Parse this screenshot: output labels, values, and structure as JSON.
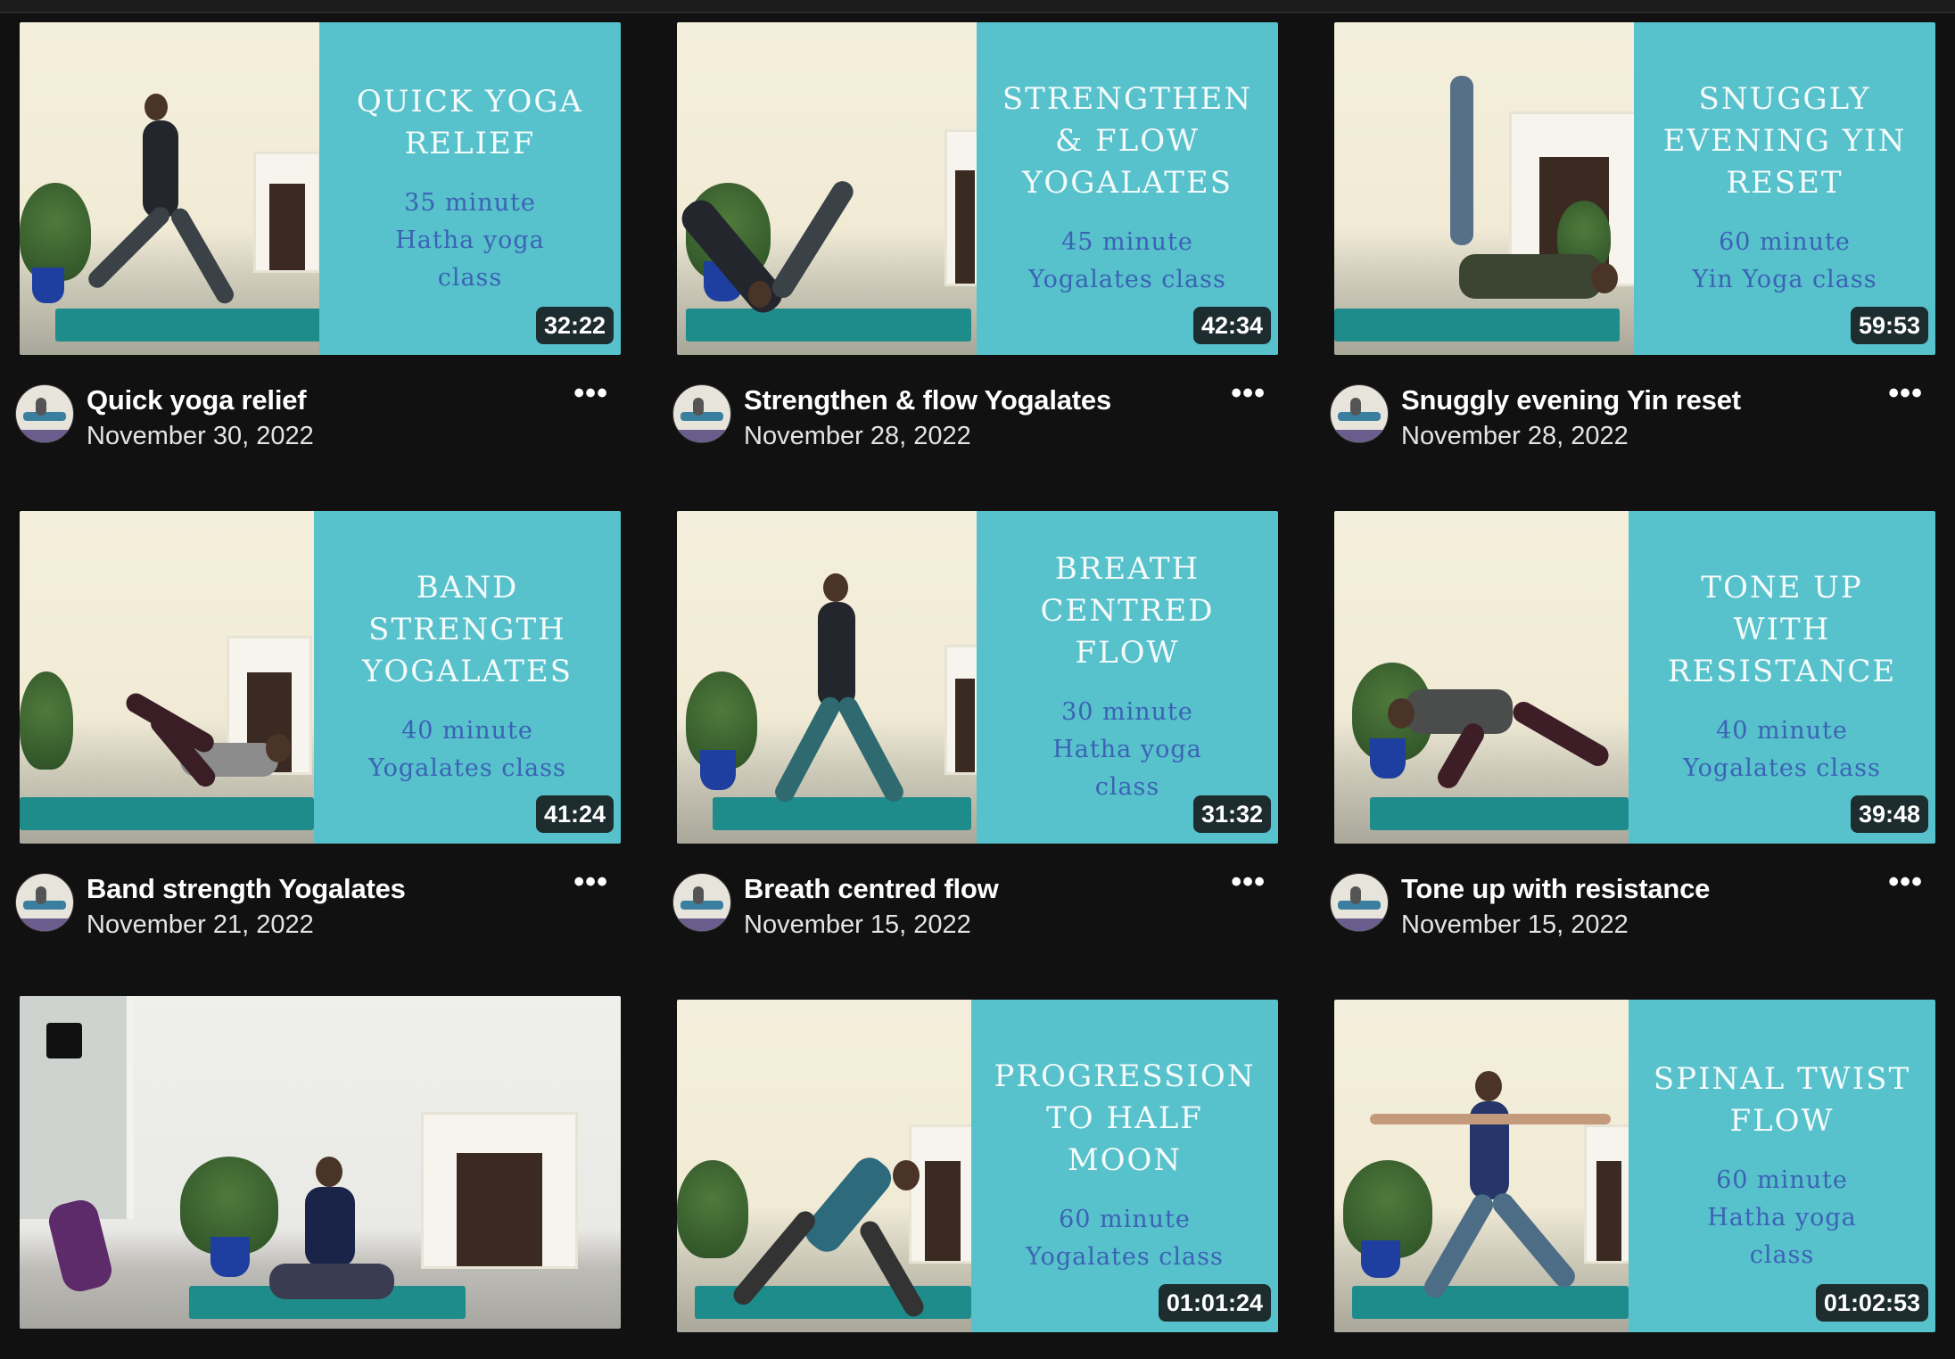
{
  "cards": [
    {
      "title": "Quick yoga relief",
      "date": "November 30, 2022",
      "duration": "32:22",
      "thumb_title": "QUICK YOGA\nRELIEF",
      "thumb_sub": "35 minute\nHatha yoga\nclass"
    },
    {
      "title": "Strengthen & flow Yogalates",
      "date": "November 28, 2022",
      "duration": "42:34",
      "thumb_title": "STRENGTHEN\n& FLOW\nYOGALATES",
      "thumb_sub": "45 minute\nYogalates class"
    },
    {
      "title": "Snuggly evening Yin reset",
      "date": "November 28, 2022",
      "duration": "59:53",
      "thumb_title": "SNUGGLY\nEVENING YIN\nRESET",
      "thumb_sub": "60 minute\nYin Yoga class"
    },
    {
      "title": "Band strength Yogalates",
      "date": "November 21, 2022",
      "duration": "41:24",
      "thumb_title": "BAND\nSTRENGTH\nYOGALATES",
      "thumb_sub": "40 minute\nYogalates class"
    },
    {
      "title": "Breath centred flow",
      "date": "November 15, 2022",
      "duration": "31:32",
      "thumb_title": "BREATH\nCENTRED\nFLOW",
      "thumb_sub": "30 minute\nHatha yoga\nclass"
    },
    {
      "title": "Tone up with resistance",
      "date": "November 15, 2022",
      "duration": "39:48",
      "thumb_title": "TONE UP\nWITH\nRESISTANCE",
      "thumb_sub": "40 minute\nYogalates class"
    },
    {
      "title": "",
      "date": "",
      "duration": "",
      "thumb_title": "",
      "thumb_sub": ""
    },
    {
      "title": "",
      "date": "",
      "duration": "01:01:24",
      "thumb_title": "PROGRESSION\nTO HALF\nMOON",
      "thumb_sub": "60 minute\nYogalates class"
    },
    {
      "title": "",
      "date": "",
      "duration": "01:02:53",
      "thumb_title": "SPINAL TWIST\nFLOW",
      "thumb_sub": "60 minute\nHatha yoga\nclass"
    }
  ],
  "more_label": "•••",
  "colors": {
    "panel": "#57c1cc",
    "panel_text": "#f5fbfb",
    "panel_sub": "#3b63b5",
    "mat": "#1f8c8c",
    "background": "#111112"
  },
  "icons": {
    "more": "more-horizontal-icon"
  }
}
